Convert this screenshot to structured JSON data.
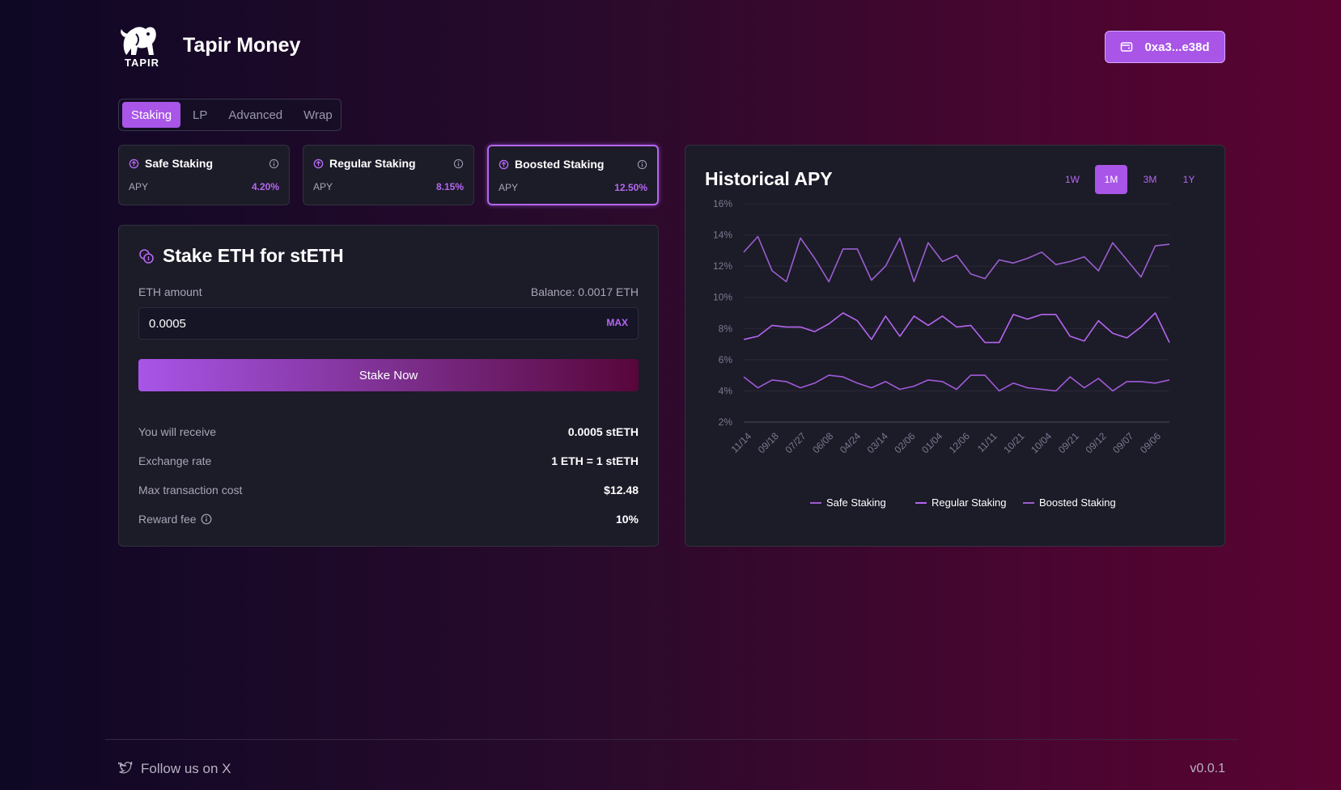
{
  "app": {
    "brand_name": "Tapir Money",
    "logo_text": "TAPIR"
  },
  "wallet": {
    "address": "0xa3...e38d"
  },
  "tabs": [
    {
      "label": "Staking",
      "active": true
    },
    {
      "label": "LP",
      "active": false
    },
    {
      "label": "Advanced",
      "active": false
    },
    {
      "label": "Wrap",
      "active": false
    }
  ],
  "options": [
    {
      "name": "Safe Staking",
      "apy_label": "APY",
      "apy": "4.20%",
      "selected": false
    },
    {
      "name": "Regular Staking",
      "apy_label": "APY",
      "apy": "8.15%",
      "selected": false
    },
    {
      "name": "Boosted Staking",
      "apy_label": "APY",
      "apy": "12.50%",
      "selected": true
    }
  ],
  "stake": {
    "title": "Stake ETH for stETH",
    "amount_label": "ETH amount",
    "balance": "Balance: 0.0017 ETH",
    "amount_value": "0.0005",
    "max_label": "MAX",
    "button_label": "Stake Now",
    "details": [
      {
        "key": "You will receive",
        "value": "0.0005 stETH"
      },
      {
        "key": "Exchange rate",
        "value": "1 ETH = 1 stETH"
      },
      {
        "key": "Max transaction cost",
        "value": "$12.48"
      },
      {
        "key": "Reward fee",
        "value": "10%"
      }
    ]
  },
  "chart_panel": {
    "title": "Historical APY",
    "ranges": [
      {
        "label": "1W",
        "active": false
      },
      {
        "label": "1M",
        "active": true
      },
      {
        "label": "3M",
        "active": false
      },
      {
        "label": "1Y",
        "active": false
      }
    ]
  },
  "chart_data": {
    "type": "line",
    "title": "Historical APY",
    "y_ticks": [
      "2%",
      "4%",
      "6%",
      "8%",
      "10%",
      "12%",
      "14%",
      "16%"
    ],
    "ylim": [
      2,
      16
    ],
    "x_tick_labels": [
      "11/14",
      "09/18",
      "07/27",
      "06/08",
      "04/24",
      "03/14",
      "02/06",
      "01/04",
      "12/06",
      "11/11",
      "10/21",
      "10/04",
      "09/21",
      "09/12",
      "09/07",
      "09/06"
    ],
    "grid": true,
    "legend_position": "bottom",
    "series": [
      {
        "name": "Safe Staking",
        "color": "#a05ad8",
        "values": [
          4.9,
          4.2,
          4.7,
          4.6,
          4.2,
          4.5,
          5.0,
          4.9,
          4.5,
          4.2,
          4.6,
          4.1,
          4.3,
          4.7,
          4.6,
          4.1,
          5.0,
          5.0,
          4.0,
          4.5,
          4.2,
          4.1,
          4.0,
          4.9,
          4.2,
          4.8,
          4.0,
          4.6,
          4.6,
          4.5,
          4.7
        ]
      },
      {
        "name": "Regular Staking",
        "color": "#b466f0",
        "values": [
          7.3,
          7.5,
          8.2,
          8.1,
          8.1,
          7.8,
          8.3,
          9.0,
          8.5,
          7.3,
          8.8,
          7.5,
          8.8,
          8.2,
          8.8,
          8.1,
          8.2,
          7.1,
          7.1,
          8.9,
          8.6,
          8.9,
          8.9,
          7.5,
          7.2,
          8.5,
          7.7,
          7.4,
          8.1,
          9.0,
          7.1
        ]
      },
      {
        "name": "Boosted Staking",
        "color": "#9a5fcf",
        "values": [
          12.9,
          13.9,
          11.7,
          11.0,
          13.8,
          12.5,
          11.0,
          13.1,
          13.1,
          11.1,
          12.0,
          13.8,
          11.0,
          13.5,
          12.3,
          12.7,
          11.5,
          11.2,
          12.4,
          12.2,
          12.5,
          12.9,
          12.1,
          12.3,
          12.6,
          11.7,
          13.5,
          12.4,
          11.3,
          13.3,
          13.4
        ]
      }
    ]
  },
  "footer": {
    "follow_label": "Follow us on X",
    "version": "v0.0.1"
  }
}
